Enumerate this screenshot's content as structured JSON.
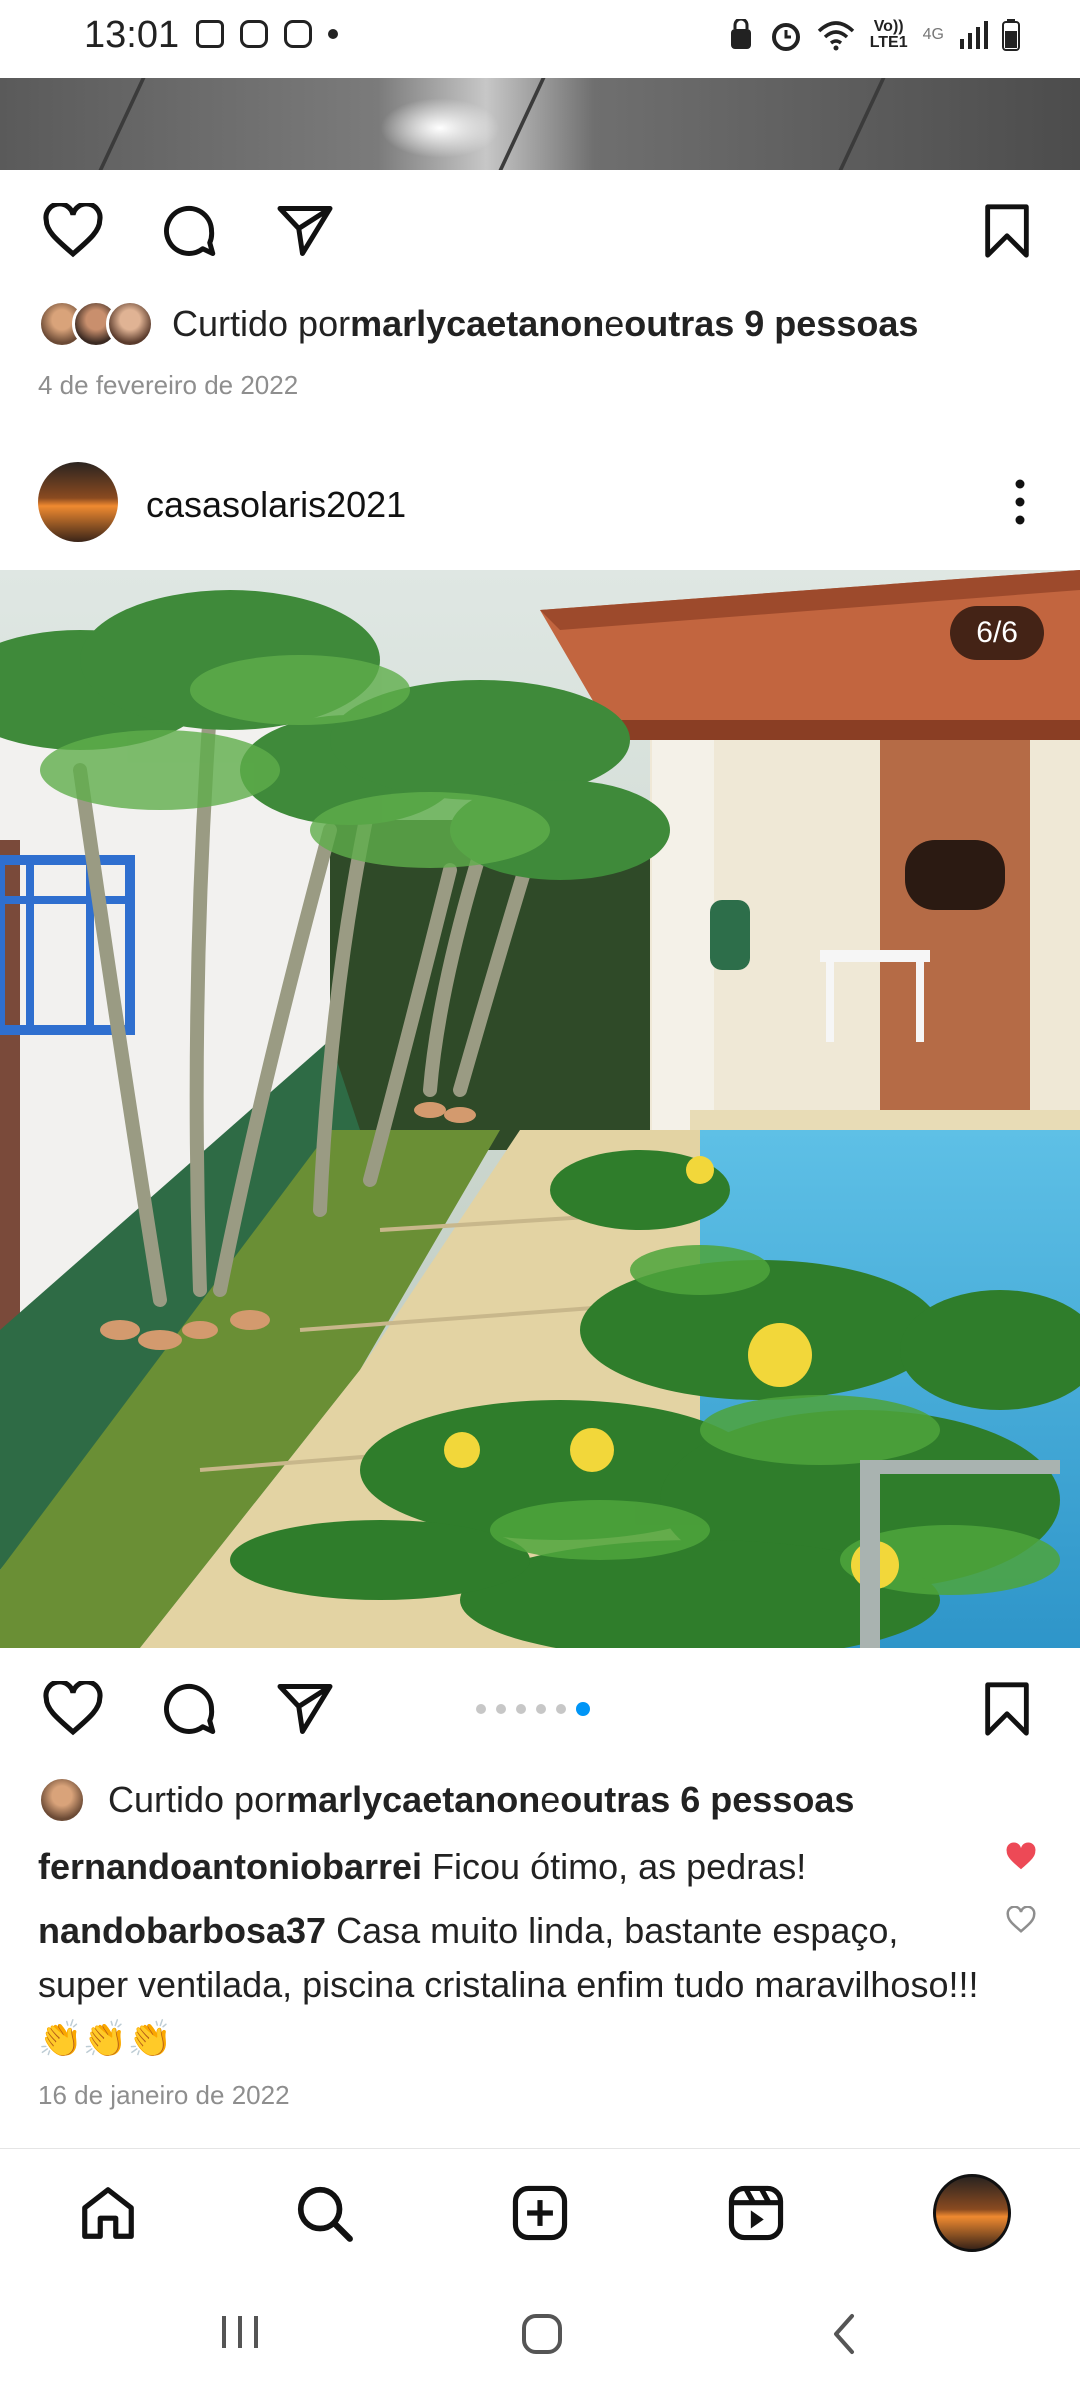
{
  "status_bar": {
    "time": "13:01",
    "network_label": "Vo)) LTE1",
    "generation": "4G"
  },
  "post1": {
    "likes_prefix": "Curtido por ",
    "likes_user": "marlycaetanon",
    "likes_middle": " e ",
    "likes_rest": "outras 9 pessoas",
    "date": "4 de fevereiro de 2022"
  },
  "post2": {
    "username": "casasolaris2021",
    "counter": "6/6",
    "carousel": {
      "total": 6,
      "active": 6
    },
    "likes_prefix": "Curtido por ",
    "likes_user": "marlycaetanon",
    "likes_middle": " e ",
    "likes_rest": "outras 6 pessoas",
    "comments": [
      {
        "user": "fernandoantoniobarrei",
        "text": " Ficou ótimo, as pedras!",
        "liked": true
      },
      {
        "user": "nandobarbosa37",
        "text": " Casa muito linda, bastante espaço, super ventilada, piscina cristalina enfim tudo maravilhoso!!!👏👏👏",
        "liked": false
      }
    ],
    "date": "16 de janeiro de 2022"
  },
  "bottom_nav": [
    "home-icon",
    "search-icon",
    "create-icon",
    "reels-icon",
    "profile-avatar"
  ],
  "colors": {
    "accent": "#0095f6",
    "like": "#ed4956",
    "muted": "#8e8e8e"
  }
}
